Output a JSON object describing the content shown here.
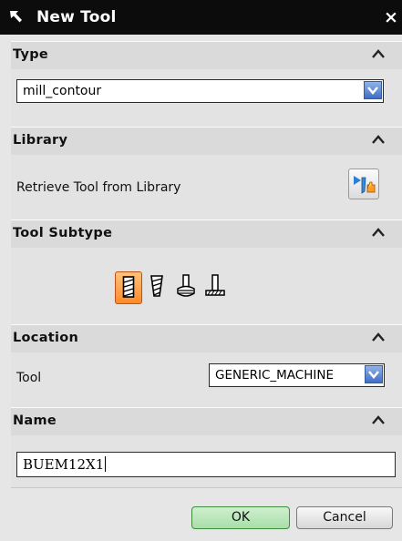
{
  "window": {
    "title": "New Tool",
    "close_glyph": "×"
  },
  "sections": {
    "type": {
      "header": "Type",
      "combo_value": "mill_contour"
    },
    "library": {
      "header": "Library",
      "retrieve_label": "Retrieve Tool from Library",
      "retrieve_icon": "retrieve-library-icon"
    },
    "tool_subtype": {
      "header": "Tool Subtype",
      "items": [
        {
          "icon": "end-mill-icon",
          "selected": true
        },
        {
          "icon": "tapered-mill-icon",
          "selected": false
        },
        {
          "icon": "ball-mill-icon",
          "selected": false
        },
        {
          "icon": "t-cutter-icon",
          "selected": false
        }
      ]
    },
    "location": {
      "header": "Location",
      "tool_label": "Tool",
      "tool_value": "GENERIC_MACHINE"
    },
    "name": {
      "header": "Name",
      "value": "BUEM12X1"
    }
  },
  "buttons": {
    "ok": "OK",
    "cancel": "Cancel"
  },
  "colors": {
    "title_bar": "#0c0c0c",
    "dialog_bg": "#e6e6e6",
    "dropdown_blue": "#3f6fc4",
    "subtype_selected": "#ff8a2a",
    "ok_button": "#a9dfa9"
  }
}
